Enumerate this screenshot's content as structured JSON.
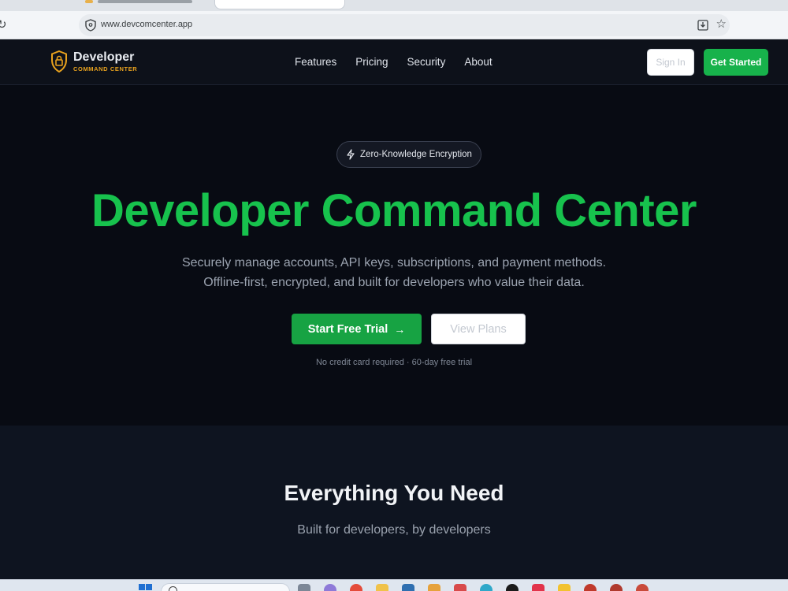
{
  "browser": {
    "url": "www.devcomcenter.app"
  },
  "header": {
    "brand_name": "Developer",
    "brand_sub": "COMMAND CENTER",
    "nav": [
      "Features",
      "Pricing",
      "Security",
      "About"
    ],
    "signin_label": "Sign In",
    "get_started_label": "Get Started"
  },
  "hero": {
    "badge": "Zero-Knowledge Encryption",
    "title": "Developer Command Center",
    "subtitle_line1": "Securely manage accounts, API keys, subscriptions, and payment methods.",
    "subtitle_line2": "Offline-first, encrypted, and built for developers who value their data.",
    "primary_cta": "Start Free Trial",
    "secondary_cta": "View Plans",
    "fine_print": "No credit card required · 60-day free trial"
  },
  "features": {
    "title": "Everything You Need",
    "subtitle": "Built for developers, by developers"
  },
  "colors": {
    "accent": "#17c24d",
    "button_green": "#17a343",
    "brand_gold": "#e8a21e",
    "background": "#080b13"
  }
}
